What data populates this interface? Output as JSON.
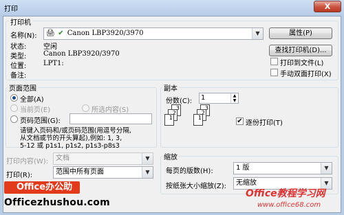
{
  "window": {
    "title": "打印",
    "close_label": "X"
  },
  "printer": {
    "group_label": "打印机",
    "name_label": "名称(N):",
    "name_value": "Canon LBP3920/3970",
    "properties_button": "属性(P)",
    "find_button": "查找打印机(D)...",
    "status_label": "状态:",
    "status_value": "空闲",
    "type_label": "类型:",
    "type_value": "Canon LBP3920/3970",
    "where_label": "位置:",
    "where_value": "LPT1:",
    "comment_label": "备注:",
    "print_to_file": "打印到文件(L)",
    "manual_duplex": "手动双面打印(X)"
  },
  "page_range": {
    "group_label": "页面范围",
    "all": "全部(A)",
    "current": "当前页(E)",
    "selection": "所选内容(S)",
    "pages": "页码范围(G):",
    "hint_line1": "请键入页码和/或页码范围(用逗号分隔,",
    "hint_line2": "从文档或节的开头算起),例如: 1, 3,",
    "hint_line3": "5-12 或 p1s1, p1s2, p1s3-p8s3"
  },
  "copies": {
    "group_label": "副本",
    "count_label": "份数(C):",
    "count_value": "1",
    "collate": "逐份打印(T)"
  },
  "print_what": {
    "label": "打印内容(W):",
    "value": "文档"
  },
  "print": {
    "label": "打印(R):",
    "value": "范围中所有页面"
  },
  "zoom": {
    "group_label": "缩放",
    "pages_per_sheet_label": "每页的版数(H):",
    "pages_per_sheet_value": "1 版",
    "scale_label": "按纸张大小缩放(Z):",
    "scale_value": "无缩放"
  },
  "overlay": {
    "banner": "Office办公助手",
    "site": "Officezhushou.com",
    "logo": "Office教程学习网",
    "logo_url": "www.office68.com"
  },
  "colors": {
    "banner_red": "#e33a1b",
    "accent_blue": "#1b4d8c"
  }
}
